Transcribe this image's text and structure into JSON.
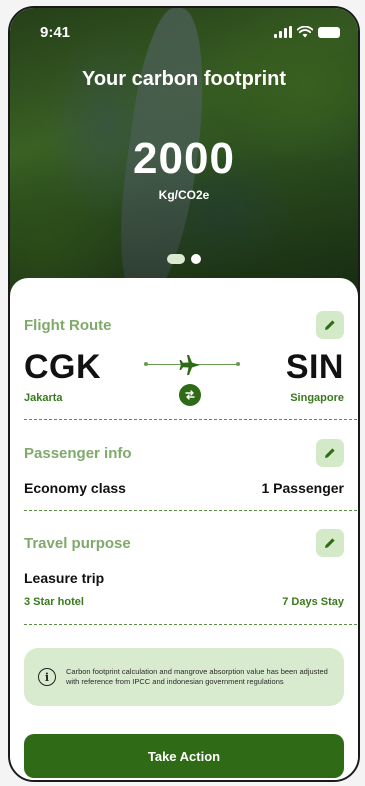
{
  "status_bar": {
    "time": "9:41"
  },
  "hero": {
    "title": "Your carbon footprint",
    "value": "2000",
    "unit": "Kg/CO2e",
    "pager": {
      "count": 2,
      "active_index": 0
    }
  },
  "flight_route": {
    "title": "Flight Route",
    "from_code": "CGK",
    "from_city": "Jakarta",
    "to_code": "SIN",
    "to_city": "Singapore"
  },
  "passenger_info": {
    "title": "Passenger info",
    "class": "Economy class",
    "passengers": "1 Passenger"
  },
  "travel_purpose": {
    "title": "Travel purpose",
    "purpose": "Leasure trip",
    "hotel": "3 Star hotel",
    "stay": "7 Days Stay"
  },
  "info_note": {
    "text": "Carbon footprint calculation and mangrove absorption value has been adjusted with reference from IPCC and indonesian government regulations"
  },
  "cta": {
    "label": "Take Action"
  },
  "colors": {
    "primary": "#2f6b16",
    "section_title": "#7faa6b",
    "accent_light": "#d3e9c7",
    "info_bg": "#d9ebcf"
  },
  "icons": {
    "edit": "pencil-icon",
    "plane": "airplane-icon",
    "swap": "swap-arrows-icon",
    "info": "info-icon"
  }
}
